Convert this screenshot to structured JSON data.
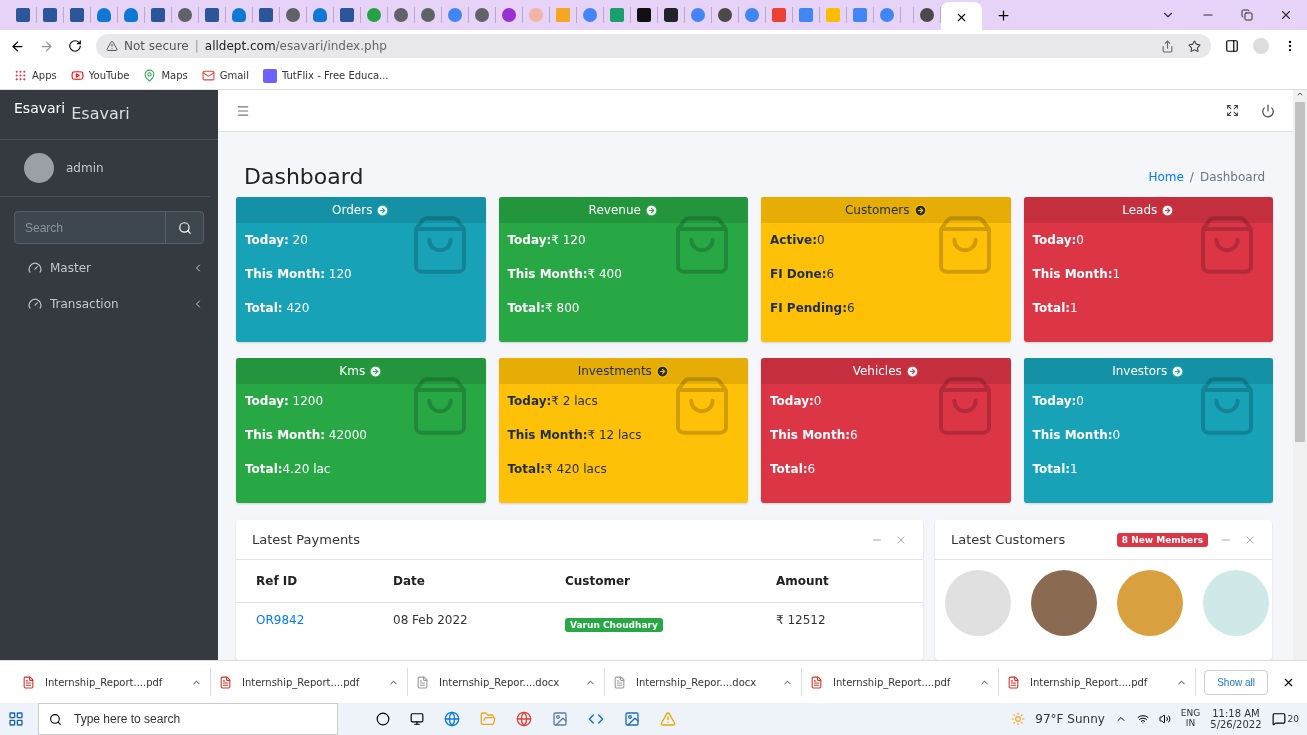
{
  "browser": {
    "tabs": [
      {
        "kind": "word",
        "selected": false
      },
      {
        "kind": "word",
        "selected": false
      },
      {
        "kind": "word",
        "selected": false
      },
      {
        "kind": "cloud",
        "selected": false
      },
      {
        "kind": "cloud",
        "selected": false
      },
      {
        "kind": "word",
        "selected": false
      },
      {
        "kind": "globe",
        "selected": false
      },
      {
        "kind": "word",
        "selected": false
      },
      {
        "kind": "cloud",
        "selected": false
      },
      {
        "kind": "word",
        "selected": false
      },
      {
        "kind": "globe",
        "selected": false
      },
      {
        "kind": "cloud",
        "selected": false
      },
      {
        "kind": "word",
        "selected": false
      },
      {
        "kind": "green",
        "selected": false
      },
      {
        "kind": "globe",
        "selected": false
      },
      {
        "kind": "globe",
        "selected": false
      },
      {
        "kind": "google",
        "selected": false
      },
      {
        "kind": "globe",
        "selected": false
      },
      {
        "kind": "purple",
        "selected": false
      },
      {
        "kind": "dots",
        "selected": false
      },
      {
        "kind": "pin",
        "selected": false
      },
      {
        "kind": "google",
        "selected": false
      },
      {
        "kind": "w",
        "selected": false
      },
      {
        "kind": "m",
        "selected": false
      },
      {
        "kind": "react",
        "selected": false
      },
      {
        "kind": "google",
        "selected": false
      },
      {
        "kind": "chrome",
        "selected": false
      },
      {
        "kind": "google",
        "selected": false
      },
      {
        "kind": "gmail",
        "selected": false
      },
      {
        "kind": "docs",
        "selected": false
      },
      {
        "kind": "drive",
        "selected": false
      },
      {
        "kind": "docs",
        "selected": false
      },
      {
        "kind": "google",
        "selected": false
      },
      {
        "kind": "blank",
        "selected": false
      },
      {
        "kind": "chrome",
        "selected": false
      },
      {
        "kind": "blank",
        "selected": true
      }
    ],
    "security": "Not secure",
    "separator": "|",
    "url_host": "alldept.com",
    "url_path": "/esavari/index.php",
    "bookmarks": [
      {
        "kind": "apps",
        "label": "Apps"
      },
      {
        "kind": "youtube",
        "label": "YouTube"
      },
      {
        "kind": "maps",
        "label": "Maps"
      },
      {
        "kind": "gmail",
        "label": "Gmail"
      },
      {
        "kind": "tf",
        "label": "TutFlix - Free Educa..."
      }
    ]
  },
  "sidebar": {
    "logo_alt": "Esavari",
    "brand": "Esavari",
    "user": "admin",
    "search": {
      "placeholder": "Search"
    },
    "items": [
      {
        "label": "Master",
        "expanded": false
      },
      {
        "label": "Transaction",
        "expanded": false
      }
    ]
  },
  "page": {
    "title": "Dashboard",
    "separator": "/",
    "breadcrumb": [
      {
        "label": "Home",
        "selected": false
      },
      {
        "label": "Dashboard",
        "selected": true
      }
    ]
  },
  "cards": [
    {
      "title": "Orders",
      "color": "#17a2b8",
      "rows": [
        {
          "label": "Today:",
          "value": " 20"
        },
        {
          "label": "This Month:",
          "value": " 120"
        },
        {
          "label": "Total:",
          "value": " 420"
        }
      ]
    },
    {
      "title": "Revenue",
      "color": "#28a745",
      "rows": [
        {
          "label": "Today:",
          "value": "₹ 120"
        },
        {
          "label": "This Month:",
          "value": "₹ 400"
        },
        {
          "label": "Total:",
          "value": "₹ 800"
        }
      ]
    },
    {
      "title": "Customers",
      "color": "#ffc107",
      "rows": [
        {
          "label": "Active:",
          "value": "0"
        },
        {
          "label": "FI Done:",
          "value": "6"
        },
        {
          "label": "FI Pending:",
          "value": "6"
        }
      ]
    },
    {
      "title": "Leads",
      "color": "#dc3545",
      "rows": [
        {
          "label": "Today:",
          "value": "0"
        },
        {
          "label": "This Month:",
          "value": "1"
        },
        {
          "label": "Total:",
          "value": "1"
        }
      ]
    },
    {
      "title": "Kms",
      "color": "#28a745",
      "rows": [
        {
          "label": "Today:",
          "value": " 1200"
        },
        {
          "label": "This Month:",
          "value": " 42000"
        },
        {
          "label": "Total:",
          "value": "4.20 lac"
        }
      ]
    },
    {
      "title": "Investments",
      "color": "#ffc107",
      "rows": [
        {
          "label": "Today:",
          "value": "₹ 2 lacs"
        },
        {
          "label": "This Month:",
          "value": "₹ 12 lacs"
        },
        {
          "label": "Total:",
          "value": "₹ 420 lacs"
        }
      ]
    },
    {
      "title": "Vehicles",
      "color": "#dc3545",
      "rows": [
        {
          "label": "Today:",
          "value": "0"
        },
        {
          "label": "This Month:",
          "value": "6"
        },
        {
          "label": "Total:",
          "value": "6"
        }
      ]
    },
    {
      "title": "Investors",
      "color": "#17a2b8",
      "rows": [
        {
          "label": "Today:",
          "value": "0"
        },
        {
          "label": "This Month:",
          "value": "0"
        },
        {
          "label": "Total:",
          "value": "1"
        }
      ]
    }
  ],
  "payments": {
    "title": "Latest Payments",
    "columns": [
      "Ref ID",
      "Date",
      "Customer",
      "Amount"
    ],
    "rows": [
      {
        "ref": "OR9842",
        "date": "08 Feb 2022",
        "customer": "Varun Choudhary",
        "amount": "₹ 12512"
      }
    ]
  },
  "customers": {
    "title": "Latest Customers",
    "badge": "8 New Members"
  },
  "downloads": {
    "items": [
      {
        "kind": "pdf",
        "name": "Internship_Report....pdf"
      },
      {
        "kind": "pdf",
        "name": "Internship_Report....pdf"
      },
      {
        "kind": "docx",
        "name": "Internship_Repor....docx"
      },
      {
        "kind": "docx",
        "name": "Internship_Repor....docx"
      },
      {
        "kind": "pdf",
        "name": "Internship_Report....pdf"
      },
      {
        "kind": "pdf",
        "name": "Internship_Report....pdf"
      }
    ],
    "show_all": "Show all"
  },
  "taskbar": {
    "search": {
      "placeholder": "Type here to search"
    },
    "weather": "97°F Sunny",
    "lang": "ENG",
    "region": "IN",
    "time": "11:18 AM",
    "date": "5/26/2022",
    "notifications": "20"
  }
}
